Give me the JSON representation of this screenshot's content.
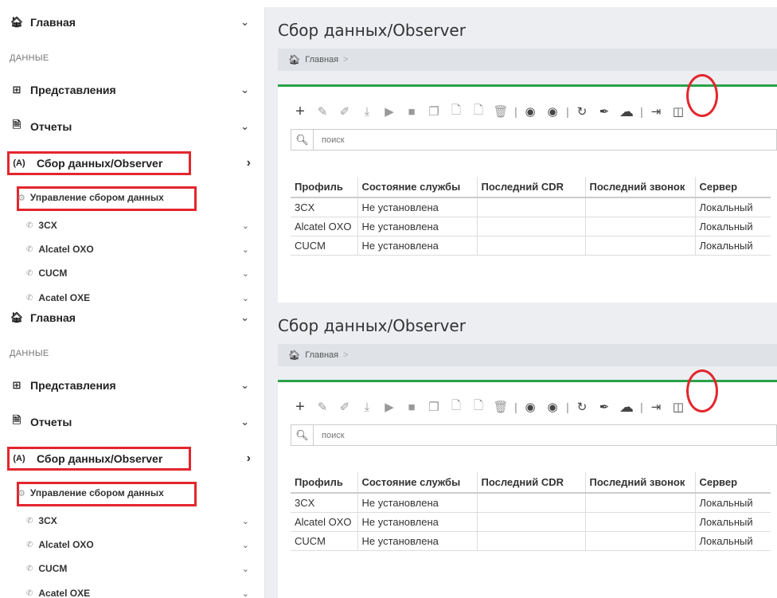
{
  "sidebar": {
    "home_label": "Главная",
    "section_label": "ДАННЫЕ",
    "views_label": "Представления",
    "reports_label": "Отчеты",
    "collection_label": "Сбор данных/Observer",
    "collection_icon_text": "(A)",
    "manage_label": "Управление сбором данных",
    "sub_items": [
      {
        "label": "3CX"
      },
      {
        "label": "Alcatel OXO"
      },
      {
        "label": "CUCM"
      },
      {
        "label": "Acatel OXE"
      }
    ]
  },
  "main": {
    "title": "Сбор данных/Observer",
    "breadcrumb": "Главная",
    "breadcrumb_sep": ">",
    "search_placeholder": "поиск",
    "columns": [
      "Профиль",
      "Состояние службы",
      "Последний CDR",
      "Последний звонок",
      "Сервер"
    ],
    "rows": [
      {
        "profile": "3CX",
        "state": "Не установлена",
        "cdr": "",
        "call": "",
        "server": "Локальный"
      },
      {
        "profile": "Alcatel OXO",
        "state": "Не установлена",
        "cdr": "",
        "call": "",
        "server": "Локальный"
      },
      {
        "profile": "CUCM",
        "state": "Не установлена",
        "cdr": "",
        "call": "",
        "server": "Локальный"
      }
    ]
  },
  "toolbar_icons": [
    "plus-icon",
    "edit-icon",
    "pencil-icon",
    "download-icon",
    "play-icon",
    "stop-icon",
    "copy-icon",
    "import-icon",
    "export-icon",
    "trash-icon",
    "start-circle-icon",
    "stop-circle-icon",
    "refresh-icon",
    "brush-icon",
    "cloud-icon",
    "sign-out-icon",
    "columns-icon"
  ],
  "colors": {
    "accent_green": "#2aa24b",
    "highlight_red": "#e3262d",
    "main_bg": "#eceef1"
  }
}
